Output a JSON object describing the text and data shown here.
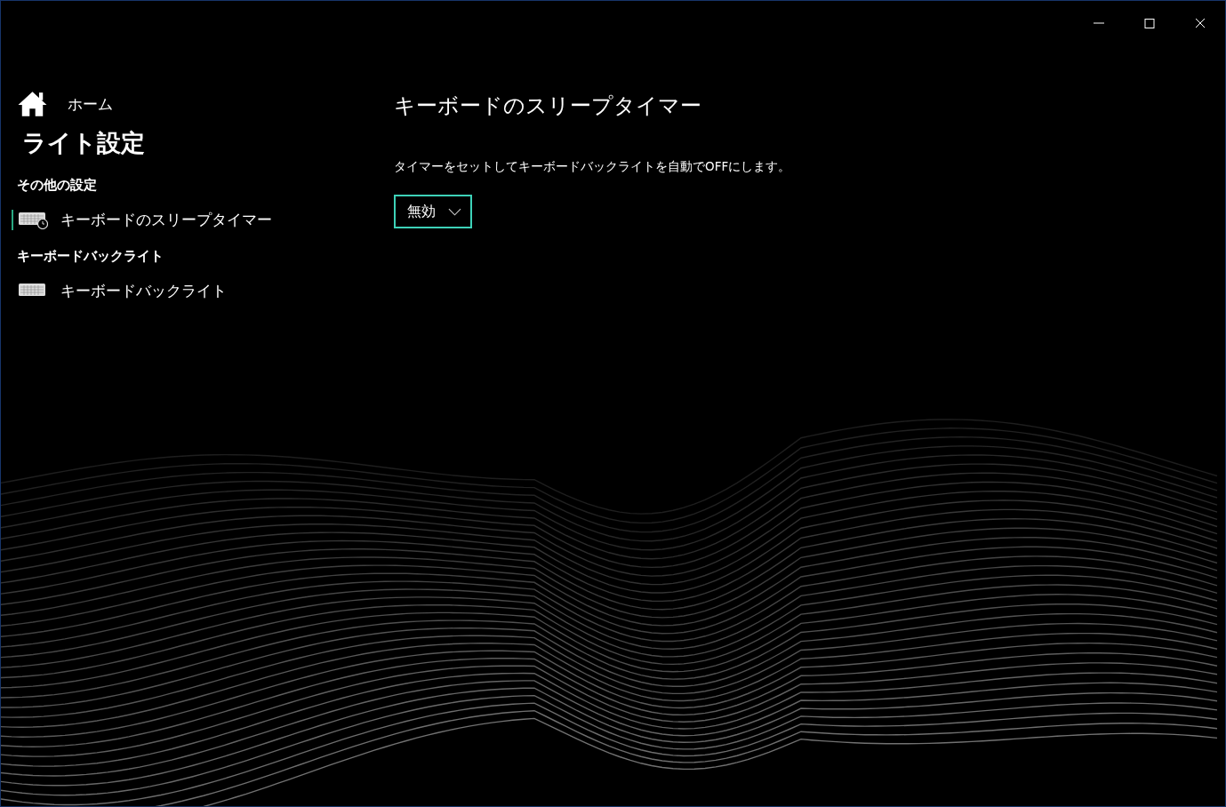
{
  "sidebar": {
    "home": {
      "label": "ホーム"
    },
    "title": "ライト設定",
    "sections": [
      {
        "heading": "その他の設定",
        "items": [
          {
            "label": "キーボードのスリープタイマー",
            "kind": "keyboard-timer",
            "selected": true
          }
        ]
      },
      {
        "heading": "キーボードバックライト",
        "items": [
          {
            "label": "キーボードバックライト",
            "kind": "keyboard",
            "selected": false
          }
        ]
      }
    ]
  },
  "page": {
    "title": "キーボードのスリープタイマー",
    "description": "タイマーをセットしてキーボードバックライトを自動でOFFにします。",
    "dropdown": {
      "value": "無効"
    }
  }
}
